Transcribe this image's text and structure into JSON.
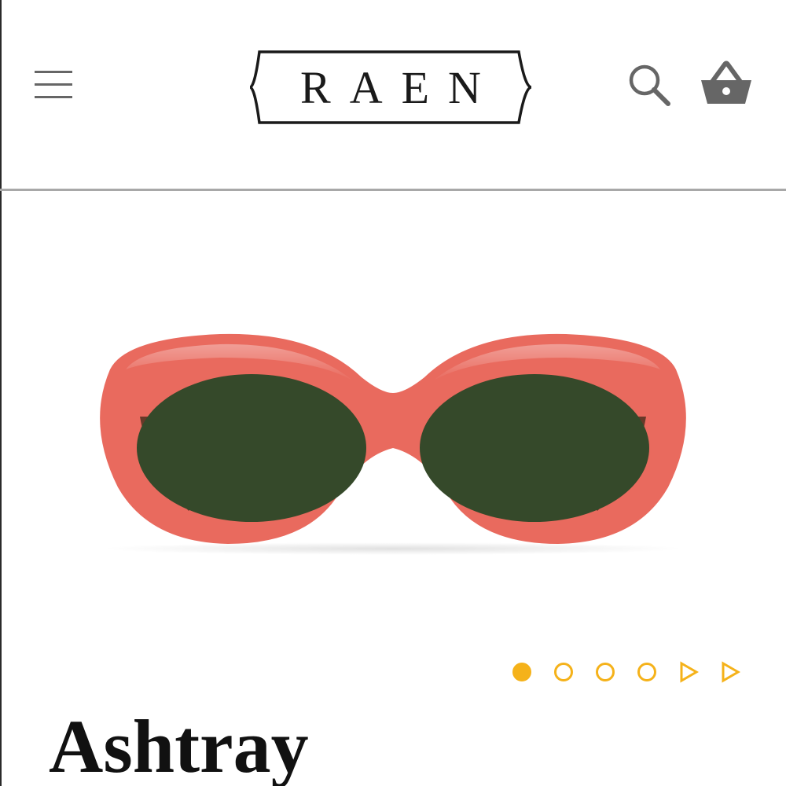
{
  "header": {
    "brand": "RAEN",
    "menu_icon": "hamburger-menu-icon",
    "search_icon": "search-icon",
    "cart_icon": "shopping-basket-icon"
  },
  "product": {
    "name": "Ashtray",
    "frame_color": "#e96a5e",
    "lens_color": "#35492a"
  },
  "carousel": {
    "slide_count": 4,
    "active_index": 0,
    "next_icons": [
      "play-arrow-icon",
      "play-arrow-icon"
    ]
  },
  "colors": {
    "accent": "#f5b21a",
    "icon_gray": "#666666",
    "divider": "#a8a8a8"
  }
}
